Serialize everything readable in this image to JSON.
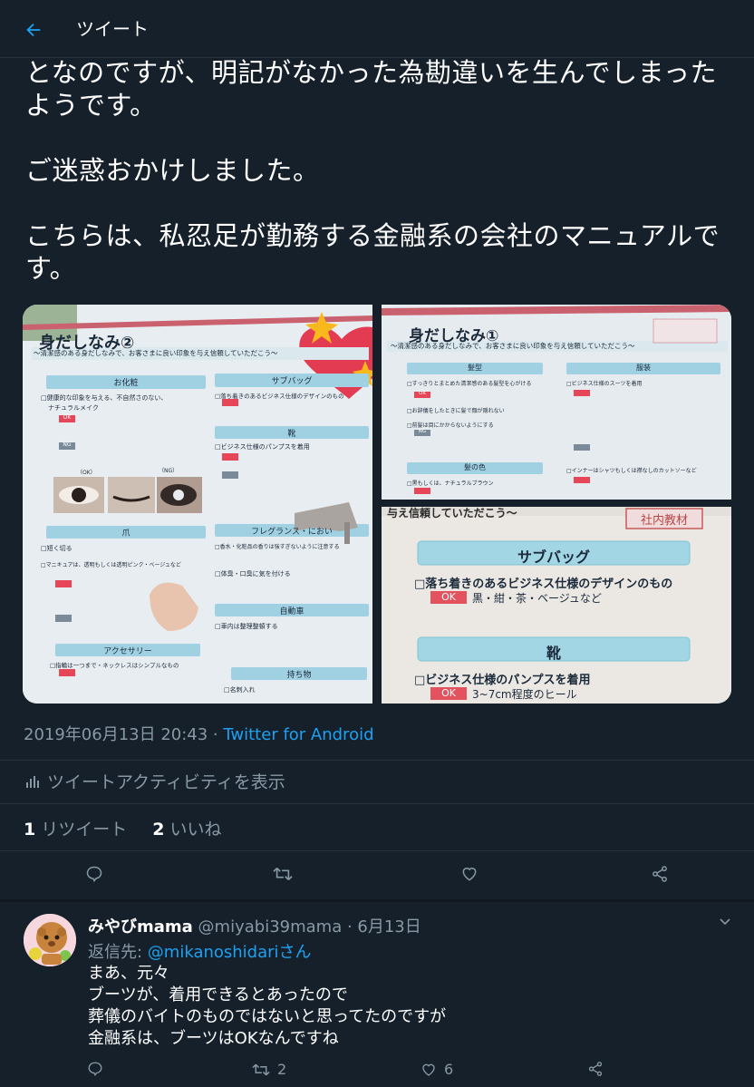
{
  "header": {
    "title": "ツイート",
    "back_icon": "back-arrow-icon"
  },
  "tweet": {
    "paragraphs": [
      "となのですが、明記がなかった為勘違いを生んでしまったようです。",
      "ご迷惑おかけしました。",
      "こちらは、私忍足が勤務する金融系の会社のマニュアルです。"
    ],
    "timestamp": "2019年06月13日 20:43 · ",
    "source": "Twitter for Android",
    "activity_label": "ツイートアクティビティを表示",
    "retweet_count": "1",
    "retweet_label": "リツイート",
    "like_count": "2",
    "like_label": "いいね"
  },
  "media": {
    "image1": {
      "title": "身だしなみ②",
      "subtitle": "～清潔感のある身だしなみで、お客さまに良い印象を与え信頼していただこう～",
      "sections": [
        "お化粧",
        "サブバッグ",
        "靴",
        "爪",
        "フレグランス・におい",
        "自動車",
        "アクセサリー",
        "持ち物"
      ],
      "ok_label": "OK",
      "ng_label": "NG",
      "lines": [
        "□健康的な印象を与える、不自然さのない、",
        "ナチュラルメイク",
        "□落ち着きのあるビジネス仕様のデザインのもの",
        "□ビジネス仕様のパンプスを着用",
        "□短く切る",
        "□マニキュアは、透明もしくは透明ピンク・ベージュなど",
        "□香水・化粧品の香りは強すぎないように注意する",
        "□体臭・口臭に気を付ける",
        "□車内は整理整頓する",
        "□指輪は一つまで・ネックレスはシンプルなもの",
        "□名刺入れ"
      ],
      "eye_labels": [
        "（OK）",
        "（NG）"
      ]
    },
    "image2": {
      "title": "身だしなみ①",
      "subtitle": "～清潔感のある身だしなみで、お客さまに良い印象を与え信頼していただこう～",
      "sections": [
        "髪型",
        "服装",
        "髪の色"
      ],
      "ok_label": "OK",
      "ng_label": "NG",
      "lines": [
        "□すっきりとまとめた清潔感のある髪型を心がける",
        "□お辞儀をしたときに髪で顔が隠れない",
        "□前髪は目にかからないようにする",
        "□ビジネス仕様のスーツを着用",
        "□インナーはシャツもしくは襟なしのカットソーなど",
        "□黒もしくは、ナチュラルブラウン"
      ]
    },
    "image3": {
      "top_text": "与え信頼していただこう～",
      "stamp": "社内教材",
      "section1": "サブバッグ",
      "line1": "□落ち着きのあるビジネス仕様のデザインのもの",
      "ok1": "OK",
      "ok1_text": "黒・紺・茶・ベージュなど",
      "section2": "靴",
      "line2": "□ビジネス仕様のパンプスを着用",
      "ok2": "OK",
      "ok2_text": "3~7cm程度のヒール"
    }
  },
  "actions": {
    "reply_icon": "reply-icon",
    "retweet_icon": "retweet-icon",
    "like_icon": "heart-icon",
    "share_icon": "share-icon"
  },
  "reply": {
    "name": "みやびmama",
    "handle": "@miyabi39mama",
    "date": " · 6月13日",
    "replying_to_label": "返信先: ",
    "replying_to": "@mikanoshidariさん",
    "body": "まあ、元々\nブーツが、着用できるとあったので\n葬儀のバイトのものではないと思ってたのですが\n金融系は、ブーツはOKなんですね",
    "retweet_count": "2",
    "like_count": "6"
  },
  "colors": {
    "background": "#15202b",
    "accent": "#1da1f2",
    "secondary_text": "#8899a6",
    "divider": "#253341"
  }
}
